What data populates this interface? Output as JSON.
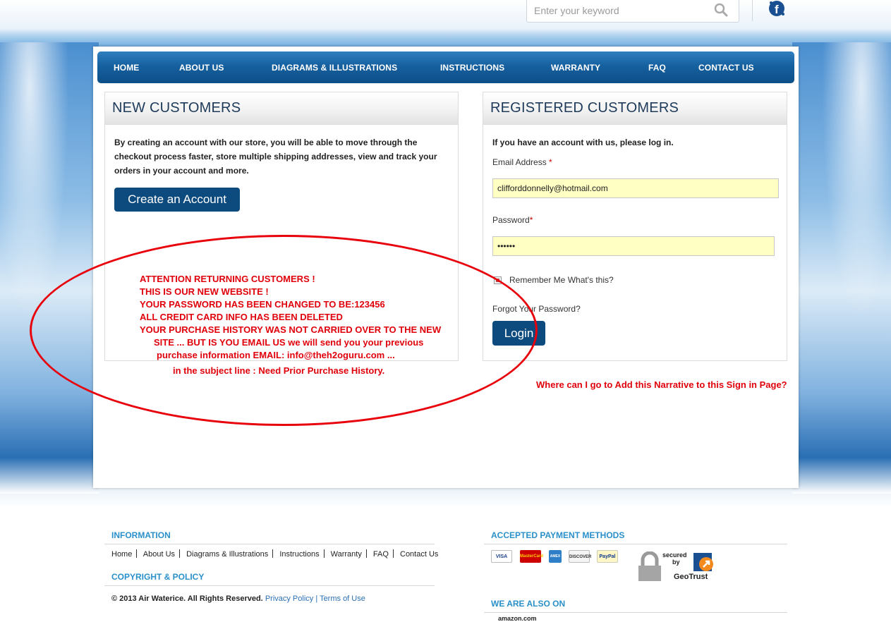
{
  "search": {
    "placeholder": "Enter your keyword"
  },
  "nav": {
    "items": [
      {
        "label": "HOME",
        "name": "nav-home"
      },
      {
        "label": "ABOUT US",
        "name": "nav-about-us"
      },
      {
        "label": "DIAGRAMS & ILLUSTRATIONS",
        "name": "nav-diagrams"
      },
      {
        "label": "INSTRUCTIONS",
        "name": "nav-instructions"
      },
      {
        "label": "WARRANTY",
        "name": "nav-warranty"
      },
      {
        "label": "FAQ",
        "name": "nav-faq"
      },
      {
        "label": "CONTACT US",
        "name": "nav-contact-us"
      }
    ]
  },
  "new_customers": {
    "title": "NEW CUSTOMERS",
    "intro": "By creating an account with our store, you will be able to move through the checkout process faster, store multiple shipping addresses, view and track your orders in your account and more.",
    "button": "Create an Account"
  },
  "registered": {
    "title": "REGISTERED CUSTOMERS",
    "intro": "If you have an account with us, please log in.",
    "email_label": "Email Address",
    "email_value": "clifforddonnelly@hotmail.com",
    "password_label": "Password",
    "password_value": "••••••",
    "required_mark": "*",
    "remember_label": "Remember Me",
    "whats_this": "What's this?",
    "forgot": "Forgot Your Password?",
    "login_button": "Login"
  },
  "annotation": {
    "lines": [
      "ATTENTION RETURNING CUSTOMERS !",
      "THIS IS OUR NEW WEBSITE !",
      "YOUR PASSWORD HAS BEEN CHANGED TO BE:123456",
      "ALL CREDIT CARD INFO HAS BEEN DELETED",
      "YOUR PURCHASE HISTORY WAS NOT CARRIED OVER TO THE NEW",
      "SITE ... BUT IS YOU EMAIL US we will send you your previous",
      "purchase information EMAIL: info@theh2oguru.com ...",
      "in the subject line : Need Prior Purchase History."
    ],
    "question": "Where can I go to Add this Narrative to this Sign in Page?",
    "color": "#e0000b"
  },
  "footer": {
    "information_title": "INFORMATION",
    "links": [
      "Home",
      "About Us",
      "Diagrams & Illustrations",
      "Instructions",
      "Warranty",
      "FAQ",
      "Contact Us"
    ],
    "copyright_title": "COPYRIGHT & POLICY",
    "copyright_text": "© 2013 Air Waterice. All Rights Reserved.",
    "privacy": "Privacy Policy",
    "link_sep": "|",
    "terms": "Terms of Use",
    "payment_title": "ACCEPTED PAYMENT METHODS",
    "payments": [
      "VISA",
      "MasterCard",
      "AMEX",
      "DISCOVER",
      "PayPal"
    ],
    "geotrust_secured": "secured",
    "geotrust_by": "by",
    "geotrust_name": "GeoTrust",
    "also_on_title": "WE ARE ALSO ON",
    "also_on": [
      "amazon.com"
    ]
  },
  "icons": {
    "search": "search-icon",
    "facebook": "facebook-icon",
    "lock": "lock-icon"
  },
  "colors": {
    "nav_blue": "#16609f",
    "button_blue": "#0d4a7e",
    "field_yellow": "#ffffc4",
    "footer_heading": "#2a90c9"
  }
}
